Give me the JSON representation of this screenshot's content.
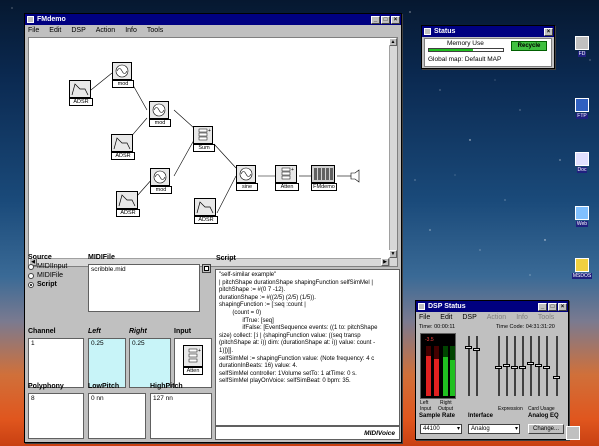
{
  "main_window": {
    "title": "FMdemo",
    "menu": [
      "File",
      "Edit",
      "DSP",
      "Action",
      "Info",
      "Tools"
    ]
  },
  "patch": {
    "modules": {
      "adsr1": "ADSR",
      "mod1": "mod",
      "adsr2": "ADSR",
      "mod2": "mod",
      "sum": "Sum",
      "adsr3": "ADSR",
      "mod3": "mod",
      "adsr4": "ADSR",
      "sine": "sine",
      "atten": "Atten",
      "fmdemo": "FMdemo"
    }
  },
  "source": {
    "label": "Source",
    "options": [
      "MIDIInput",
      "MIDIFile",
      "Script"
    ],
    "selected": "Script"
  },
  "midifile": {
    "label": "MIDIFile",
    "value": "scribble.mid"
  },
  "script": {
    "label": "Script",
    "lines": [
      "\"self-similar example\"",
      "| pitchShape durationShape shapingFunction selfSimMel |",
      "pitchShape := #(0 7 -12).",
      "durationShape := #((2/5) (2/5) (1/5)).",
      "shapingFunction := [:seq :count |",
      "        (count = 0)",
      "              ifTrue: [seq]",
      "              ifFalse: [EventSequence events: ((1 to: pitchShape",
      "size) collect: [:i | (shapingFunction value: ((seq transp",
      "(pitchShape at: i)) dim: (durationShape at: i)) value: count -",
      "1)])]].",
      "selfSimMel := shapingFunction value: (Note frequency: 4 c",
      "durationInBeats: 16) value: 4.",
      "selfSimMel controller: 1Volume setTo: 1 atTime: 0 s.",
      "selfSimMel playOnVoice: selfSimBeat: 0 bpm: 35."
    ]
  },
  "channel": {
    "label": "Channel",
    "value": "1"
  },
  "left": {
    "label": "Left",
    "value": "0.25"
  },
  "right": {
    "label": "Right",
    "value": "0.25"
  },
  "input": {
    "label": "Input",
    "module": "Atten"
  },
  "polyphony": {
    "label": "Polyphony",
    "value": "8"
  },
  "lowpitch": {
    "label": "LowPitch",
    "value": "0 nn"
  },
  "highpitch": {
    "label": "HighPitch",
    "value": "127 nn"
  },
  "brand": "MIDIVoice",
  "status_window": {
    "title": "Status",
    "memory_label": "Memory Use",
    "memory_fraction": 0.6,
    "recycle_label": "Recycle",
    "global_map": "Global map: Default MAP"
  },
  "dsp_window": {
    "title": "DSP Status",
    "menu": [
      "File",
      "Edit",
      "DSP",
      "Action",
      "Info",
      "Tools"
    ],
    "menu_disabled": [
      "Action",
      "Info",
      "Tools"
    ],
    "time_label": "Time:",
    "time_value": "00:00:11",
    "time_code_label": "Time Code:",
    "time_code_value": "04:31:31:20",
    "left_value": "-3.5",
    "left_label": "Left",
    "right_label": "Right",
    "input_label": "Input",
    "output_label": "Output",
    "expression_label": "Expression",
    "card_usage_label": "Card Usage",
    "sample_rate_label": "Sample Rate",
    "sample_rate_value": "44100",
    "interface_label": "Interface",
    "interface_value": "Analog",
    "analog_eq_label": "Analog EQ",
    "analog_eq_button": "Change...",
    "colors": {
      "meter_left": "#e02020",
      "meter_right": "#20c020"
    }
  },
  "desktop_icons": [
    {
      "label": "FD",
      "icon": "floppy-icon"
    },
    {
      "label": "FTP",
      "icon": "ftp-icon"
    },
    {
      "label": "Doc",
      "icon": "document-icon"
    },
    {
      "label": "Web",
      "icon": "web-icon"
    },
    {
      "label": "MSDOS",
      "icon": "msdos-icon"
    }
  ]
}
